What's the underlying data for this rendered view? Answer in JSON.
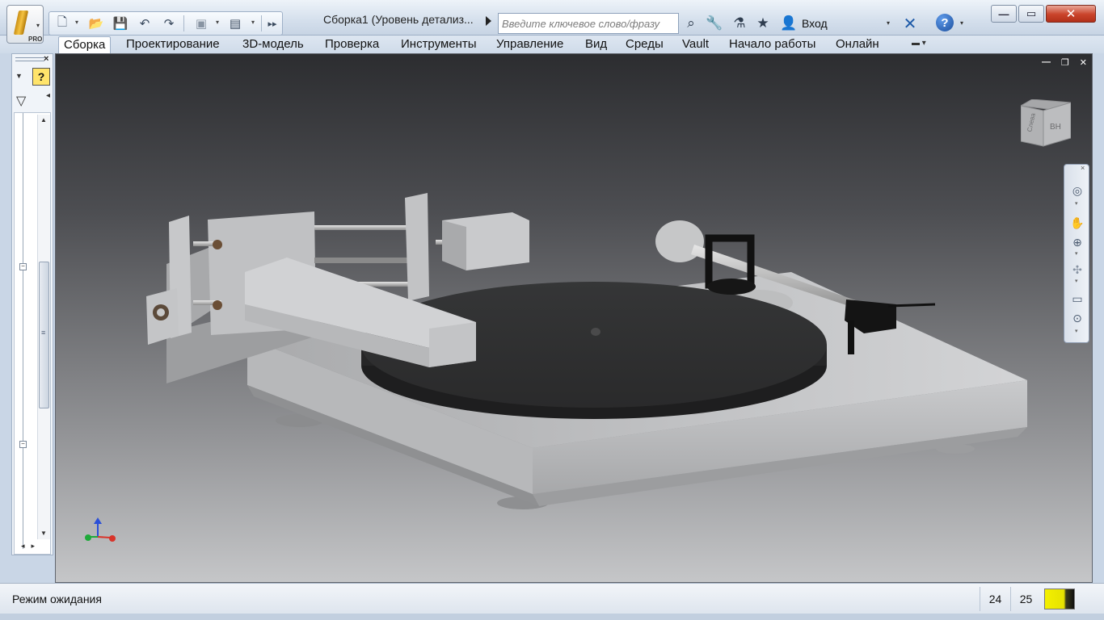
{
  "app": {
    "document_title": "Сборка1 (Уровень детализ...",
    "app_button_badge": "PRO"
  },
  "search": {
    "placeholder": "Введите ключевое слово/фразу"
  },
  "account": {
    "login_label": "Вход"
  },
  "ribbon": {
    "tabs": [
      {
        "label": "Сборка",
        "active": true
      },
      {
        "label": "Проектирование"
      },
      {
        "label": "3D-модель"
      },
      {
        "label": "Проверка"
      },
      {
        "label": "Инструменты"
      },
      {
        "label": "Управление"
      },
      {
        "label": "Вид"
      },
      {
        "label": "Среды"
      },
      {
        "label": "Vault"
      },
      {
        "label": "Начало работы"
      },
      {
        "label": "Онлайн"
      }
    ]
  },
  "viewcube": {
    "face_left": "Слева",
    "face_front": "ВН"
  },
  "status": {
    "message": "Режим ожидания",
    "value_a": "24",
    "value_b": "25"
  },
  "colors": {
    "accent": "#ffe46b",
    "viewport_top": "#2c2d30",
    "viewport_bottom": "#c5c6c8",
    "close_button": "#c9432a"
  },
  "icons": {
    "qat": [
      "new-file-icon",
      "open-folder-icon",
      "save-icon",
      "undo-icon",
      "redo-icon",
      "material-icon",
      "appearance-icon",
      "overflow-icon"
    ],
    "titlebar_tools": [
      "binoculars-icon",
      "wrench-icon",
      "satellite-icon",
      "star-icon",
      "user-icon",
      "exchange-icon",
      "help-icon"
    ],
    "navbar": [
      "steering-wheel-icon",
      "pan-icon",
      "zoom-icon",
      "orbit-icon",
      "look-at-icon",
      "zoom-window-icon"
    ]
  }
}
